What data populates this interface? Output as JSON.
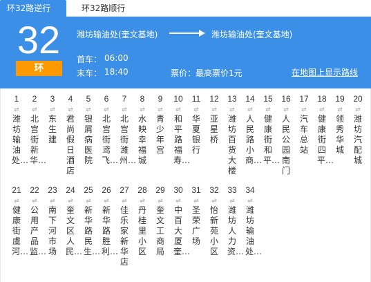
{
  "tabs": [
    {
      "label": "环32路逆行"
    },
    {
      "label": "环32路顺行"
    }
  ],
  "route": {
    "number": "32",
    "sub": "环",
    "from": "潍坊输油处(奎文基地)",
    "to": "潍坊输油处(奎文基地)",
    "first_label": "首车：",
    "first_time": "06:00",
    "last_label": "末车：",
    "last_time": "18:40",
    "fare": "票价：最高票价1元",
    "map_link": "在地图上显示路线"
  },
  "colors": {
    "header_bg": "#3b8fe6",
    "badge_bg": "#ff9900"
  },
  "direction_glyph": "⇌",
  "stations": [
    {
      "num": "1",
      "name": "潍坊输油处…"
    },
    {
      "num": "2",
      "name": "北宫街新华…"
    },
    {
      "num": "3",
      "name": "东生建"
    },
    {
      "num": "4",
      "name": "君尚假日酒店"
    },
    {
      "num": "5",
      "name": "银屑病医院"
    },
    {
      "num": "6",
      "name": "北宫街鸢飞…"
    },
    {
      "num": "7",
      "name": "北宫街潍州…"
    },
    {
      "num": "8",
      "name": "水映幸福城"
    },
    {
      "num": "9",
      "name": "青少年宫"
    },
    {
      "num": "10",
      "name": "和平路福寿…"
    },
    {
      "num": "11",
      "name": "华夏银行"
    },
    {
      "num": "12",
      "name": "亚星桥"
    },
    {
      "num": "13",
      "name": "潍坊百货大楼"
    },
    {
      "num": "14",
      "name": "人民路小商…"
    },
    {
      "num": "15",
      "name": "健康街和平…"
    },
    {
      "num": "16",
      "name": "人民公园南门"
    },
    {
      "num": "17",
      "name": "汽车总站"
    },
    {
      "num": "18",
      "name": "健康街四平…"
    },
    {
      "num": "19",
      "name": "领秀华城"
    },
    {
      "num": "20",
      "name": "潍坊汽配城"
    },
    {
      "num": "21",
      "name": "健康街虞河…"
    },
    {
      "num": "22",
      "name": "公用产品监…"
    },
    {
      "num": "23",
      "name": "南下河市场"
    },
    {
      "num": "24",
      "name": "奎文区人民…"
    },
    {
      "num": "25",
      "name": "新华路民生…"
    },
    {
      "num": "26",
      "name": "新华路胜利…"
    },
    {
      "num": "27",
      "name": "佳乐家新华店"
    },
    {
      "num": "28",
      "name": "丹桂里小区"
    },
    {
      "num": "29",
      "name": "奎文工商局"
    },
    {
      "num": "30",
      "name": "中百大厦奎…"
    },
    {
      "num": "31",
      "name": "圣荣广场"
    },
    {
      "num": "32",
      "name": "怡新苑小区"
    },
    {
      "num": "33",
      "name": "潍坊人力资…"
    },
    {
      "num": "34",
      "name": "潍坊输油处…"
    }
  ]
}
